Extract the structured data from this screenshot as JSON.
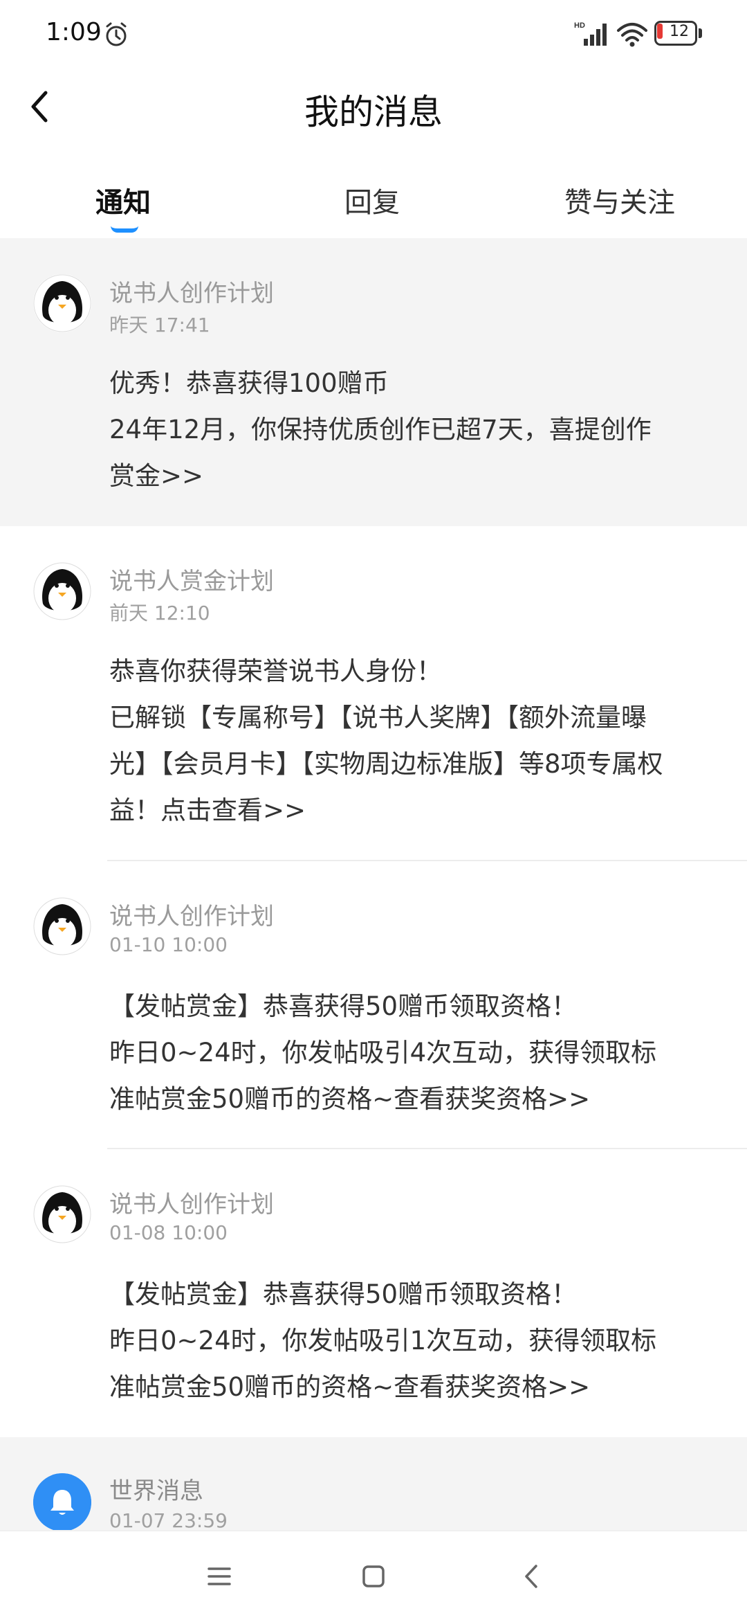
{
  "status_bar": {
    "time": "1:09",
    "battery_level": "12",
    "icons": [
      "alarm-icon",
      "signal-icon",
      "wifi-icon",
      "battery-icon"
    ]
  },
  "header": {
    "title": "我的消息",
    "back_icon": "chevron-left-icon"
  },
  "tabs": [
    {
      "label": "通知",
      "active": true
    },
    {
      "label": "回复",
      "active": false
    },
    {
      "label": "赞与关注",
      "active": false
    }
  ],
  "accent_color": "#1e90ff",
  "messages": [
    {
      "sender": "说书人创作计划",
      "time": "昨天 17:41",
      "lines": [
        "优秀！恭喜获得100赠币",
        "24年12月，你保持优质创作已超7天，喜提创作",
        "赏金>>"
      ],
      "avatar": "penguin-avatar",
      "highlighted": true
    },
    {
      "sender": "说书人赏金计划",
      "time": "前天 12:10",
      "lines": [
        "恭喜你获得荣誉说书人身份！",
        "已解锁【专属称号】【说书人奖牌】【额外流量曝",
        "光】【会员月卡】【实物周边标准版】等8项专属权",
        "益！点击查看>>"
      ],
      "avatar": "penguin-avatar",
      "highlighted": false
    },
    {
      "sender": "说书人创作计划",
      "time": "01-10 10:00",
      "lines": [
        "【发帖赏金】恭喜获得50赠币领取资格！",
        "昨日0~24时，你发帖吸引4次互动，获得领取标",
        "准帖赏金50赠币的资格~查看获奖资格>>"
      ],
      "avatar": "penguin-avatar",
      "highlighted": false
    },
    {
      "sender": "说书人创作计划",
      "time": "01-08 10:00",
      "lines": [
        "【发帖赏金】恭喜获得50赠币领取资格！",
        "昨日0~24时，你发帖吸引1次互动，获得领取标",
        "准帖赏金50赠币的资格~查看获奖资格>>"
      ],
      "avatar": "penguin-avatar",
      "highlighted": false
    },
    {
      "sender": "世界消息",
      "time": "01-07 23:59",
      "lines": [],
      "avatar": "bell-icon",
      "highlighted": true
    }
  ],
  "nav_bar": {
    "buttons": [
      "menu-icon",
      "home-square-icon",
      "back-triangle-icon"
    ]
  }
}
